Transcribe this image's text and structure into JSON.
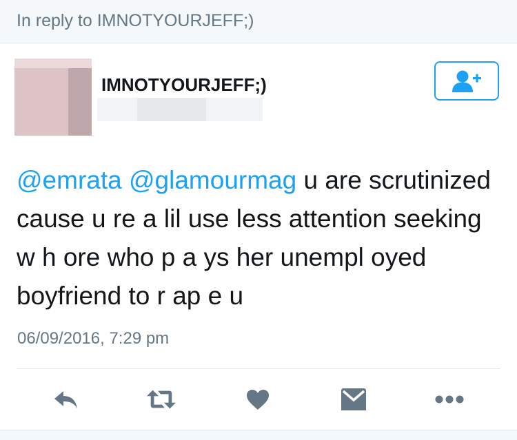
{
  "reply_header": {
    "text": "In reply to IMNOTYOURJEFF;)"
  },
  "author": {
    "display_name": "IMNOTYOURJEFF;)"
  },
  "tweet": {
    "mention_1": "@emrata",
    "mention_2": "@glamourmag",
    "body": "u are scrutinized cause u re a lil use less attention seeking w h ore who p a ys her unempl oyed boyfriend to r ap e u",
    "timestamp": "06/09/2016, 7:29 pm"
  },
  "colors": {
    "accent": "#1da1f2",
    "action_icon": "#657786",
    "text": "#14171a",
    "muted": "#657786"
  },
  "icons": {
    "follow": "follow-user-icon",
    "reply": "reply-icon",
    "retweet": "retweet-icon",
    "like": "heart-icon",
    "message": "message-icon",
    "more": "more-icon"
  }
}
